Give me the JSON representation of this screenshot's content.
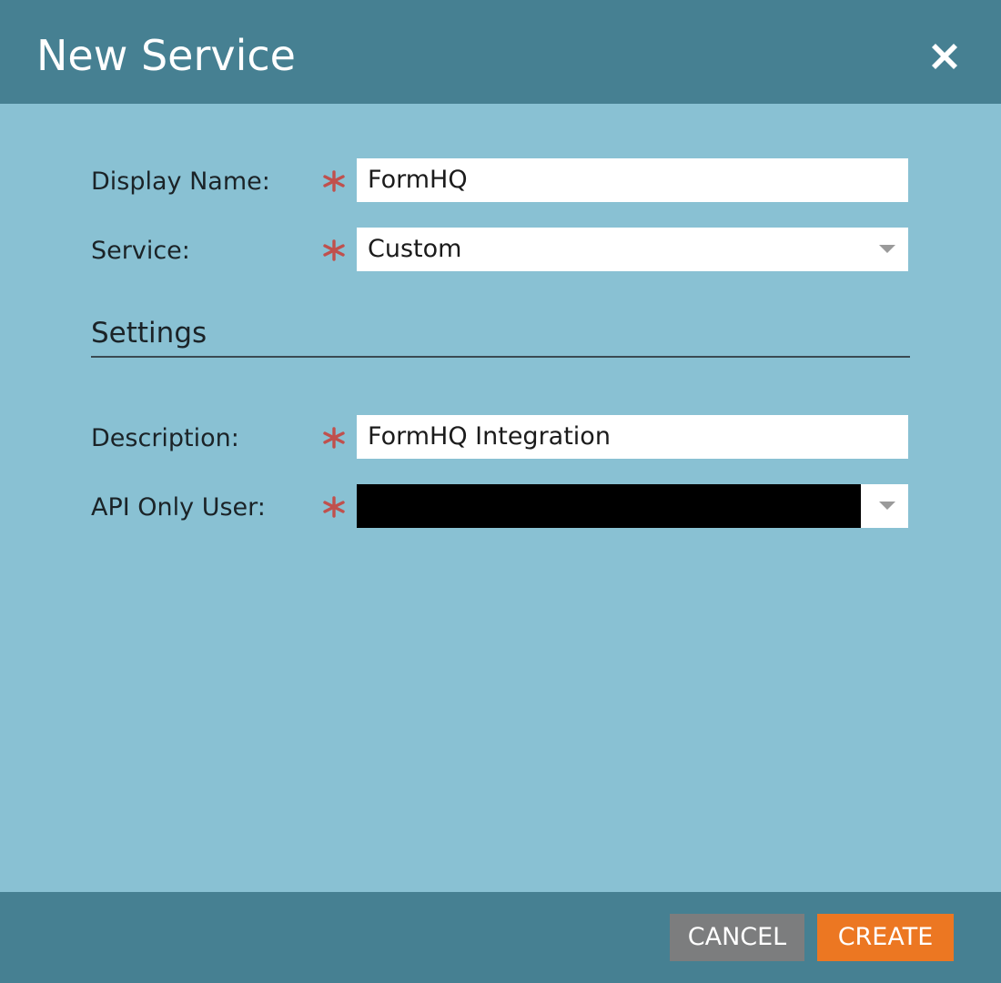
{
  "dialog": {
    "title": "New Service",
    "close_icon": "close-icon"
  },
  "form": {
    "display_name": {
      "label": "Display Name:",
      "value": "FormHQ",
      "required": true
    },
    "service": {
      "label": "Service:",
      "value": "Custom",
      "required": true
    },
    "settings_heading": "Settings",
    "description": {
      "label": "Description:",
      "value": "FormHQ Integration",
      "required": true
    },
    "api_only_user": {
      "label": "API Only User:",
      "value": "",
      "required": true,
      "redacted": true
    }
  },
  "footer": {
    "cancel_label": "CANCEL",
    "create_label": "CREATE"
  },
  "colors": {
    "header_bg": "#468092",
    "body_bg": "#89c1d3",
    "required_asterisk": "#c0504d",
    "cancel_button": "#7c7d7e",
    "create_button": "#ec7722"
  }
}
